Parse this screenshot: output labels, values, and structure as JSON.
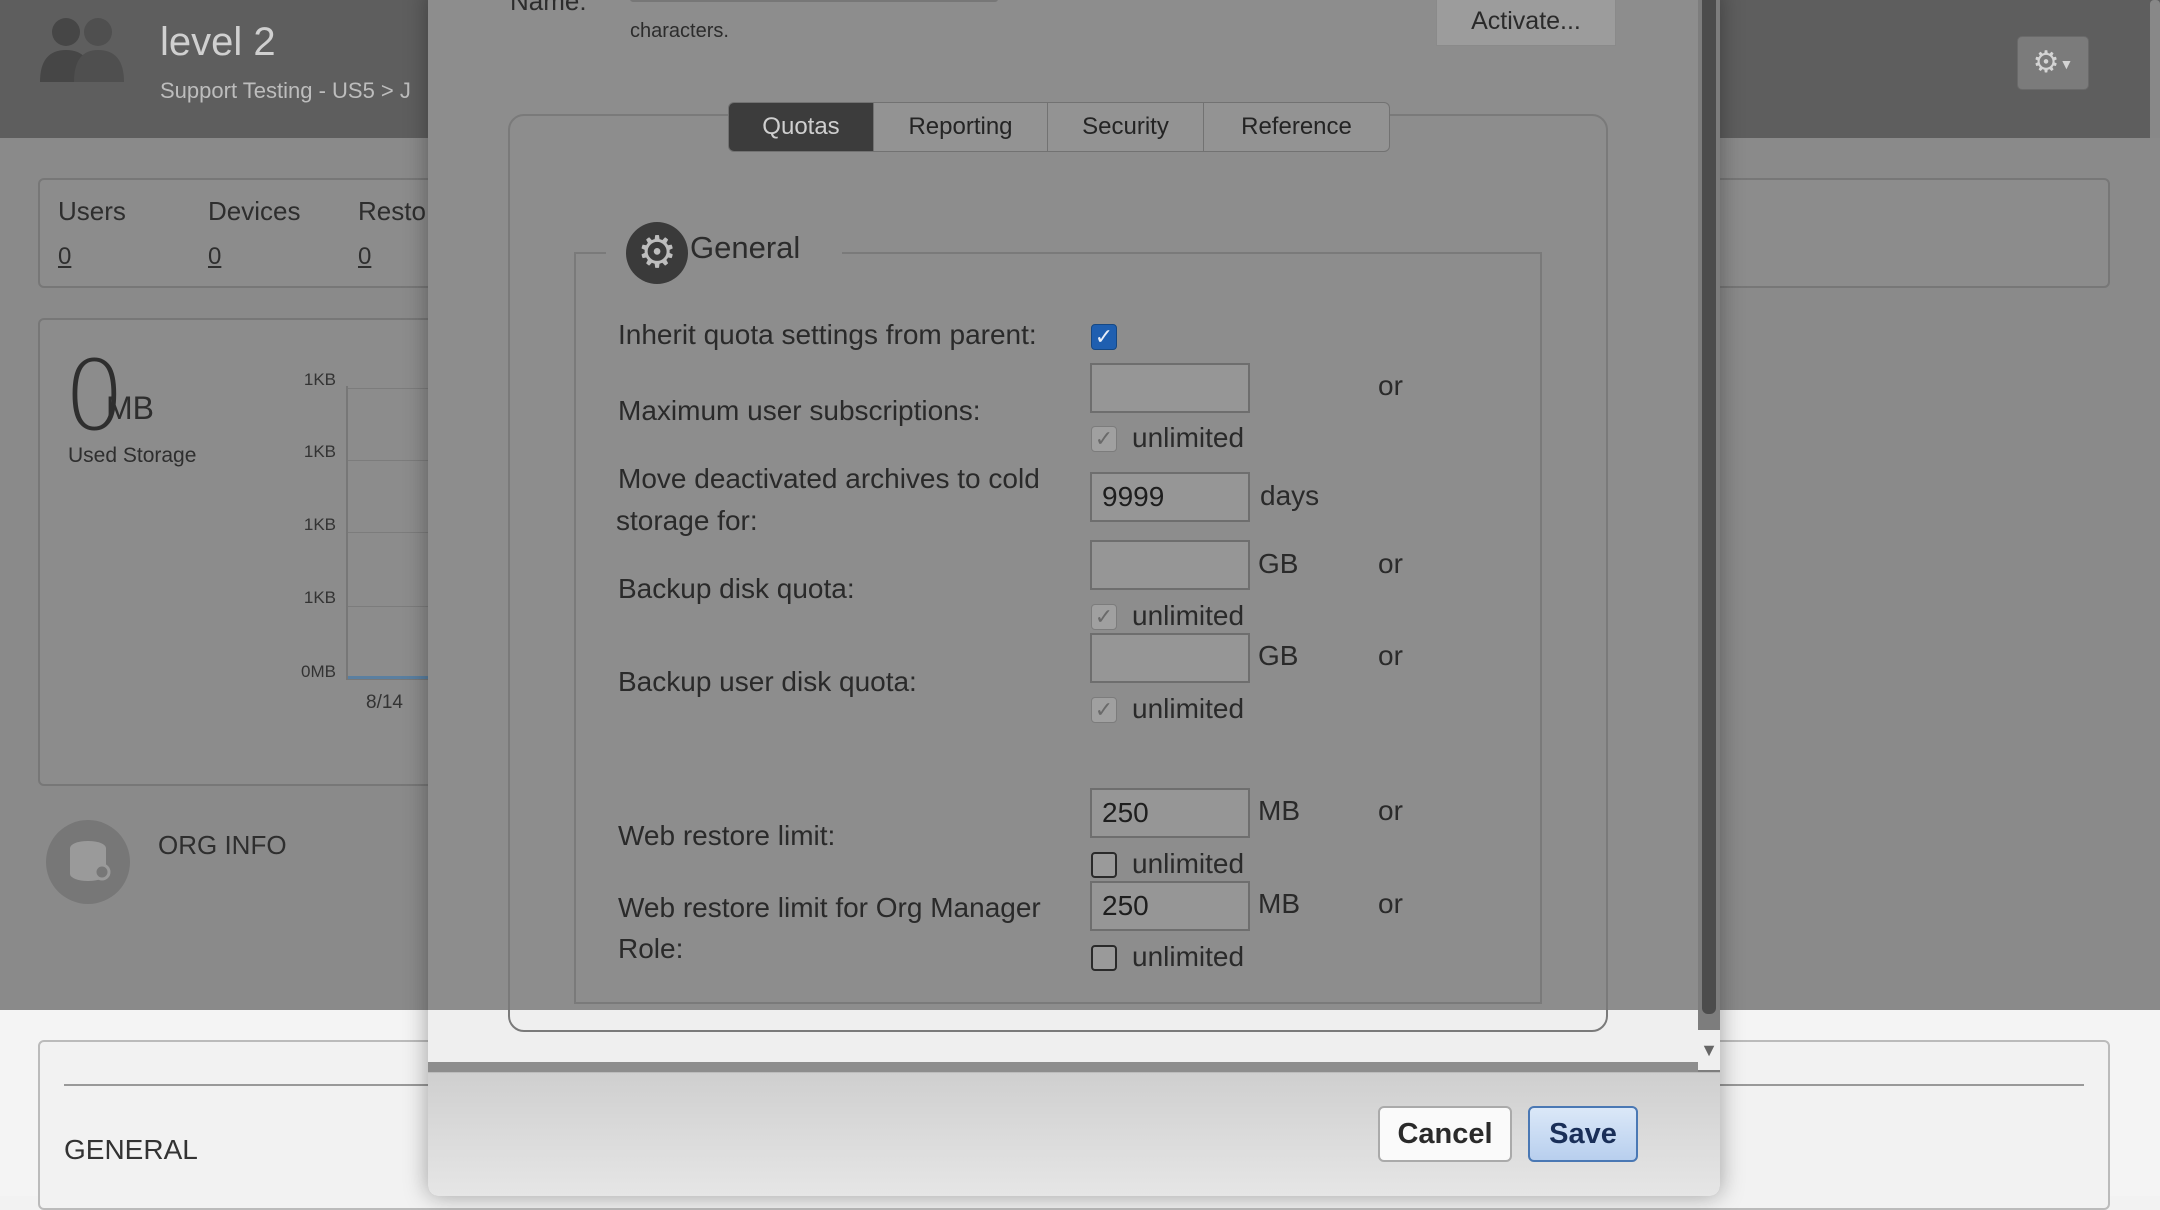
{
  "background": {
    "org_title": "level 2",
    "breadcrumb": "Support Testing - US5 > J",
    "stats": [
      {
        "label": "Users",
        "value": "0"
      },
      {
        "label": "Devices",
        "value": "0"
      },
      {
        "label": "Resto",
        "value": "0"
      }
    ],
    "storage": {
      "value": "0",
      "unit": "MB",
      "label": "Used Storage"
    },
    "chart_data": {
      "type": "line",
      "title": "",
      "xlabel": "",
      "ylabel": "",
      "y_ticks": [
        "1KB",
        "1KB",
        "1KB",
        "1KB",
        "0MB"
      ],
      "x_ticks": [
        "8/14"
      ],
      "series": [
        {
          "values": [
            0
          ]
        }
      ]
    },
    "org_info_label": "ORG INFO",
    "general_heading": "GENERAL"
  },
  "modal": {
    "name_label": "Name:",
    "name_value": "",
    "chars_hint": "characters.",
    "activate_label": "Activate...",
    "tabs": [
      {
        "label": "Quotas",
        "active": true
      },
      {
        "label": "Reporting",
        "active": false
      },
      {
        "label": "Security",
        "active": false
      },
      {
        "label": "Reference",
        "active": false
      }
    ],
    "section_title": "General",
    "fields": {
      "inherit": {
        "label": "Inherit quota settings from parent:",
        "checked": true
      },
      "max_subs": {
        "label": "Maximum user subscriptions:",
        "value": "",
        "unlimited_label": "unlimited",
        "or": "or"
      },
      "cold_storage": {
        "label_line1": "Move deactivated archives to cold",
        "label_line2": "storage for:",
        "value": "9999",
        "unit": "days"
      },
      "backup_disk": {
        "label": "Backup disk quota:",
        "value": "",
        "unit": "GB",
        "unlimited_label": "unlimited",
        "or": "or"
      },
      "backup_user_disk": {
        "label": "Backup user disk quota:",
        "value": "",
        "unit": "GB",
        "unlimited_label": "unlimited",
        "or": "or"
      },
      "web_restore": {
        "label": "Web restore limit:",
        "value": "250",
        "unit": "MB",
        "unlimited_label": "unlimited",
        "or": "or"
      },
      "web_restore_org": {
        "label_line1": "Web restore limit for Org Manager",
        "label_line2": "Role:",
        "value": "250",
        "unit": "MB",
        "unlimited_label": "unlimited",
        "or": "or"
      }
    },
    "buttons": {
      "cancel": "Cancel",
      "save": "Save"
    },
    "icons": {
      "gear": "gear-icon",
      "users": "users-icon",
      "scroll_down": "scroll-down-icon"
    }
  }
}
